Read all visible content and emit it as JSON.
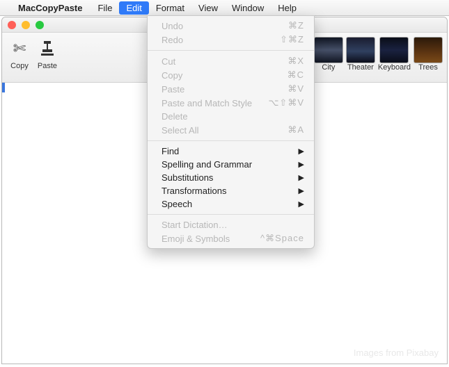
{
  "menubar": {
    "appName": "MacCopyPaste",
    "items": [
      {
        "label": "File",
        "active": false
      },
      {
        "label": "Edit",
        "active": true
      },
      {
        "label": "Format",
        "active": false
      },
      {
        "label": "View",
        "active": false
      },
      {
        "label": "Window",
        "active": false
      },
      {
        "label": "Help",
        "active": false
      }
    ]
  },
  "toolbar": {
    "copy": "Copy",
    "paste": "Paste",
    "thumbs": [
      {
        "label": "City",
        "cls": "city"
      },
      {
        "label": "Theater",
        "cls": "theater"
      },
      {
        "label": "Keyboard",
        "cls": "keyboard"
      },
      {
        "label": "Trees",
        "cls": "trees"
      }
    ]
  },
  "dropdown": {
    "groups": [
      [
        {
          "label": "Undo",
          "shortcut": "⌘Z",
          "disabled": true
        },
        {
          "label": "Redo",
          "shortcut": "⇧⌘Z",
          "disabled": true
        }
      ],
      [
        {
          "label": "Cut",
          "shortcut": "⌘X",
          "disabled": true
        },
        {
          "label": "Copy",
          "shortcut": "⌘C",
          "disabled": true
        },
        {
          "label": "Paste",
          "shortcut": "⌘V",
          "disabled": true
        },
        {
          "label": "Paste and Match Style",
          "shortcut": "⌥⇧⌘V",
          "disabled": true
        },
        {
          "label": "Delete",
          "shortcut": "",
          "disabled": true
        },
        {
          "label": "Select All",
          "shortcut": "⌘A",
          "disabled": true
        }
      ],
      [
        {
          "label": "Find",
          "submenu": true
        },
        {
          "label": "Spelling and Grammar",
          "submenu": true
        },
        {
          "label": "Substitutions",
          "submenu": true
        },
        {
          "label": "Transformations",
          "submenu": true
        },
        {
          "label": "Speech",
          "submenu": true
        }
      ],
      [
        {
          "label": "Start Dictation…",
          "disabled": true
        },
        {
          "label": "Emoji & Symbols",
          "shortcut": "^⌘Space",
          "disabled": true
        }
      ]
    ]
  },
  "credit": "Images from Pixabay"
}
